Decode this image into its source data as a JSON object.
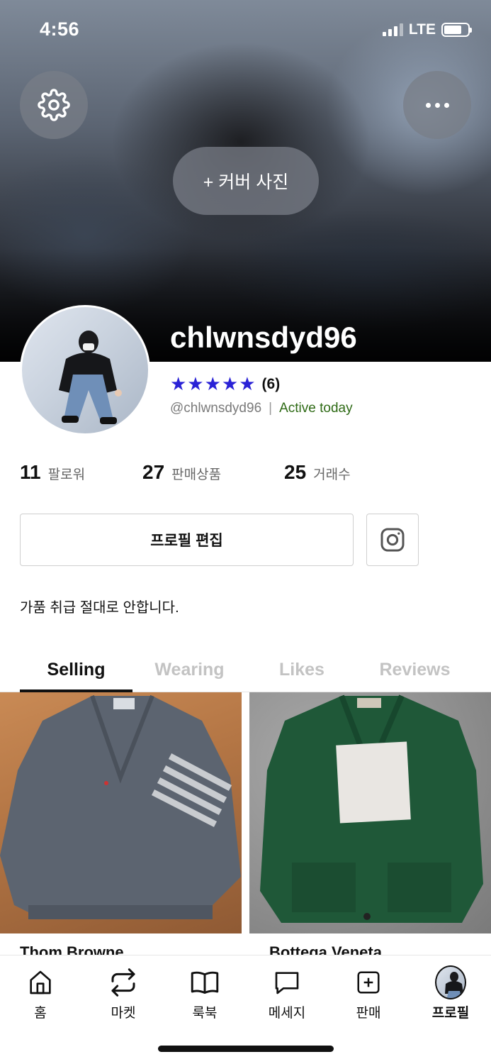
{
  "status_bar": {
    "time": "4:56",
    "network": "LTE",
    "battery_level": 0.75
  },
  "cover": {
    "add_cover_label": "+ 커버 사진",
    "settings_icon": "gear-icon",
    "more_icon": "more-horizontal-icon"
  },
  "profile": {
    "username": "chlwnsdyd96",
    "stars": "★★★★★",
    "rating_value": 5,
    "review_count": "(6)",
    "handle": "@chlwnsdyd96",
    "separator": "|",
    "activity": "Active today",
    "bio": "가품 취급 절대로 안합니다."
  },
  "stats": [
    {
      "value": "11",
      "label": "팔로워"
    },
    {
      "value": "27",
      "label": "판매상품"
    },
    {
      "value": "25",
      "label": "거래수"
    }
  ],
  "actions": {
    "edit_profile": "프로필 편집",
    "instagram_icon": "instagram-icon"
  },
  "tabs": [
    {
      "label": "Selling",
      "active": true
    },
    {
      "label": "Wearing",
      "active": false
    },
    {
      "label": "Likes",
      "active": false
    },
    {
      "label": "Reviews",
      "active": false
    }
  ],
  "products": [
    {
      "title": "Thom Browne"
    },
    {
      "title": "Bottega Veneta"
    }
  ],
  "bottom_nav": [
    {
      "label": "홈",
      "icon": "home-icon"
    },
    {
      "label": "마켓",
      "icon": "repeat-icon"
    },
    {
      "label": "룩북",
      "icon": "book-icon"
    },
    {
      "label": "메세지",
      "icon": "message-icon"
    },
    {
      "label": "판매",
      "icon": "plus-square-icon"
    },
    {
      "label": "프로필",
      "icon": "profile-avatar",
      "active": true
    }
  ],
  "colors": {
    "star": "#2a22d6",
    "active_status": "#2e6a15",
    "inactive_tab": "#c3c3c3"
  }
}
